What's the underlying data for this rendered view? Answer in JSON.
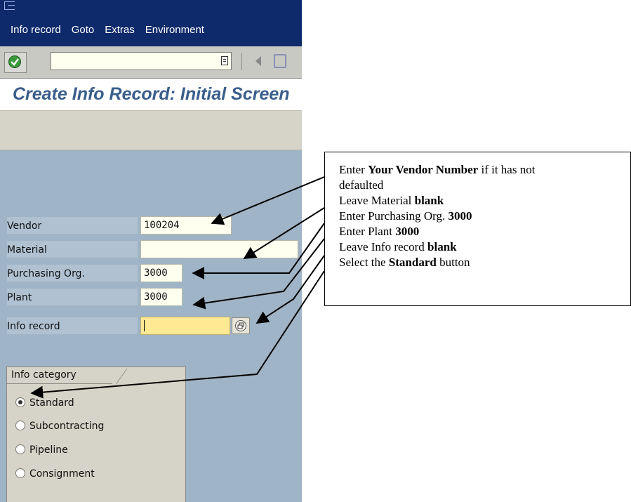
{
  "menubar": {
    "items": [
      {
        "label": "Info record"
      },
      {
        "label": "Goto"
      },
      {
        "label": "Extras"
      },
      {
        "label": "Environment"
      }
    ]
  },
  "toolbar": {
    "command_value": "",
    "enter_icon": "green-check-icon",
    "back_icon": "back-arrow-icon",
    "save_icon": "save-icon"
  },
  "page": {
    "title": "Create Info Record: Initial Screen"
  },
  "form": {
    "vendor": {
      "label": "Vendor",
      "value": "100204"
    },
    "material": {
      "label": "Material",
      "value": ""
    },
    "purch_org": {
      "label": "Purchasing Org.",
      "value": "3000"
    },
    "plant": {
      "label": "Plant",
      "value": "3000"
    },
    "info_record": {
      "label": "Info record",
      "value": ""
    }
  },
  "info_category": {
    "title": "Info category",
    "options": [
      {
        "label": "Standard",
        "selected": true
      },
      {
        "label": "Subcontracting",
        "selected": false
      },
      {
        "label": "Pipeline",
        "selected": false
      },
      {
        "label": "Consignment",
        "selected": false
      }
    ]
  },
  "callout": {
    "l1_pre": "Enter ",
    "l1_bold": "Your Vendor Number",
    "l1_post": " if it has not",
    "l2": "defaulted",
    "l3_pre": "Leave Material ",
    "l3_bold": "blank",
    "l4_pre": "Enter Purchasing Org. ",
    "l4_bold": "3000",
    "l5_pre": "Enter Plant ",
    "l5_bold": "3000",
    "l6_pre": "Leave Info record ",
    "l6_bold": "blank",
    "l7_pre": "Select the ",
    "l7_bold": "Standard",
    "l7_post": " button"
  },
  "colors": {
    "menubar_bg": "#0f2a6b",
    "screen_bg": "#9fb4c6",
    "title_color": "#3a5e8c",
    "active_field": "#ffe992"
  }
}
